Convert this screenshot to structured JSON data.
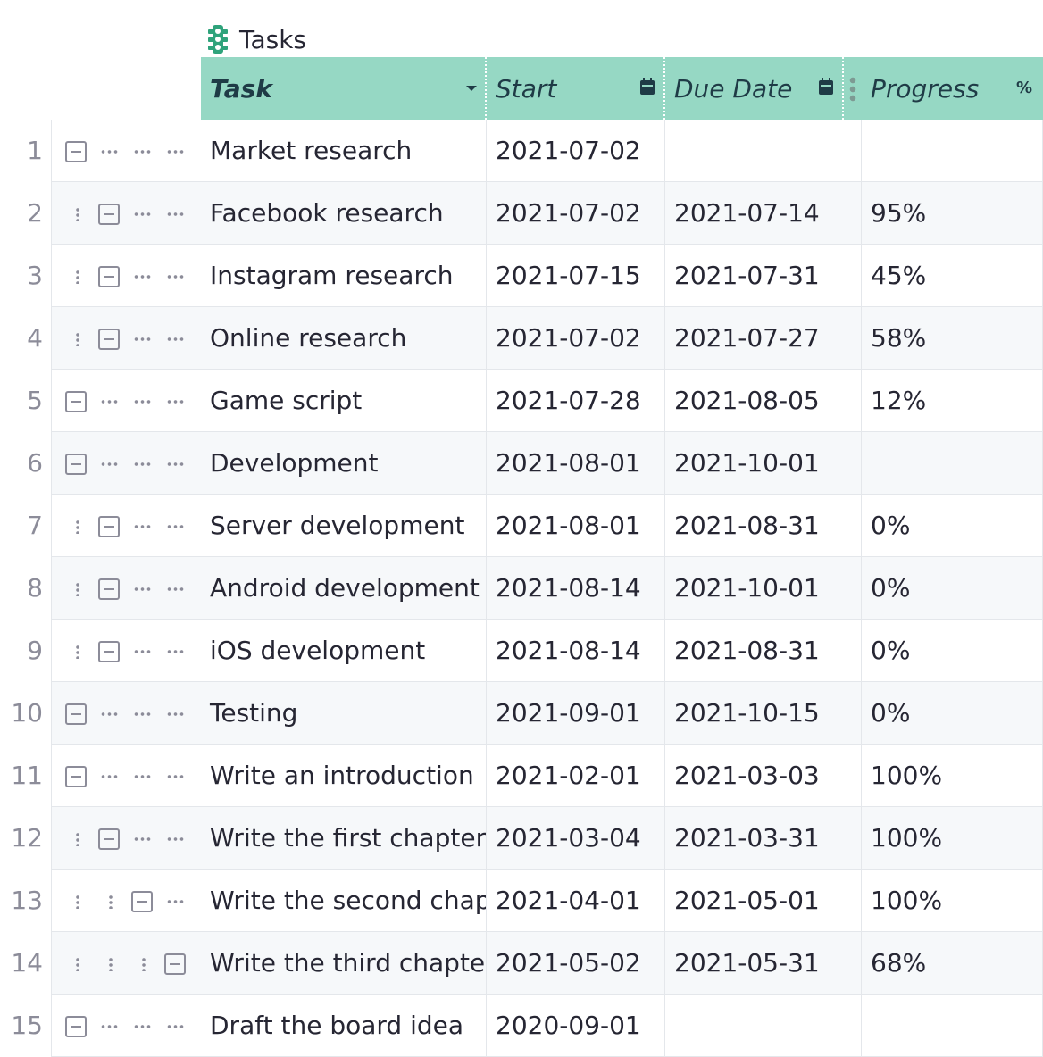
{
  "widget": {
    "title": "Tasks",
    "icon": "traffic-light-icon"
  },
  "colors": {
    "header_bg": "#96d8c4",
    "header_text": "#1f3b46",
    "row_alt": "#f6f8fa",
    "icon": "#2fa37b"
  },
  "columns": [
    {
      "key": "task",
      "label": "Task",
      "type_icon": "dropdown-caret-icon"
    },
    {
      "key": "start",
      "label": "Start",
      "type_icon": "calendar-icon"
    },
    {
      "key": "due",
      "label": "Due Date",
      "type_icon": "calendar-icon"
    },
    {
      "key": "progress",
      "label": "Progress",
      "type_icon": "percent-icon",
      "type_glyph": "%"
    }
  ],
  "rows": [
    {
      "num": "1",
      "depth": 0,
      "task": "Market research",
      "start": "2021-07-02",
      "due": "",
      "progress": ""
    },
    {
      "num": "2",
      "depth": 1,
      "task": "Facebook research",
      "start": "2021-07-02",
      "due": "2021-07-14",
      "progress": "95%"
    },
    {
      "num": "3",
      "depth": 1,
      "task": "Instagram research",
      "start": "2021-07-15",
      "due": "2021-07-31",
      "progress": "45%"
    },
    {
      "num": "4",
      "depth": 1,
      "task": "Online research",
      "start": "2021-07-02",
      "due": "2021-07-27",
      "progress": "58%"
    },
    {
      "num": "5",
      "depth": 0,
      "task": "Game script",
      "start": "2021-07-28",
      "due": "2021-08-05",
      "progress": "12%"
    },
    {
      "num": "6",
      "depth": 0,
      "task": "Development",
      "start": "2021-08-01",
      "due": "2021-10-01",
      "progress": ""
    },
    {
      "num": "7",
      "depth": 1,
      "task": "Server development",
      "start": "2021-08-01",
      "due": "2021-08-31",
      "progress": "0%"
    },
    {
      "num": "8",
      "depth": 1,
      "task": "Android development",
      "start": "2021-08-14",
      "due": "2021-10-01",
      "progress": "0%"
    },
    {
      "num": "9",
      "depth": 1,
      "task": "iOS development",
      "start": "2021-08-14",
      "due": "2021-08-31",
      "progress": "0%"
    },
    {
      "num": "10",
      "depth": 0,
      "task": "Testing",
      "start": "2021-09-01",
      "due": "2021-10-15",
      "progress": "0%"
    },
    {
      "num": "11",
      "depth": 0,
      "task": "Write an introduction",
      "start": "2021-02-01",
      "due": "2021-03-03",
      "progress": "100%"
    },
    {
      "num": "12",
      "depth": 1,
      "task": "Write the first chapter",
      "start": "2021-03-04",
      "due": "2021-03-31",
      "progress": "100%"
    },
    {
      "num": "13",
      "depth": 2,
      "task": "Write the second chapter",
      "start": "2021-04-01",
      "due": "2021-05-01",
      "progress": "100%"
    },
    {
      "num": "14",
      "depth": 3,
      "task": "Write the third chapter",
      "start": "2021-05-02",
      "due": "2021-05-31",
      "progress": "68%"
    },
    {
      "num": "15",
      "depth": 0,
      "task": "Draft the board idea",
      "start": "2020-09-01",
      "due": "",
      "progress": ""
    }
  ]
}
